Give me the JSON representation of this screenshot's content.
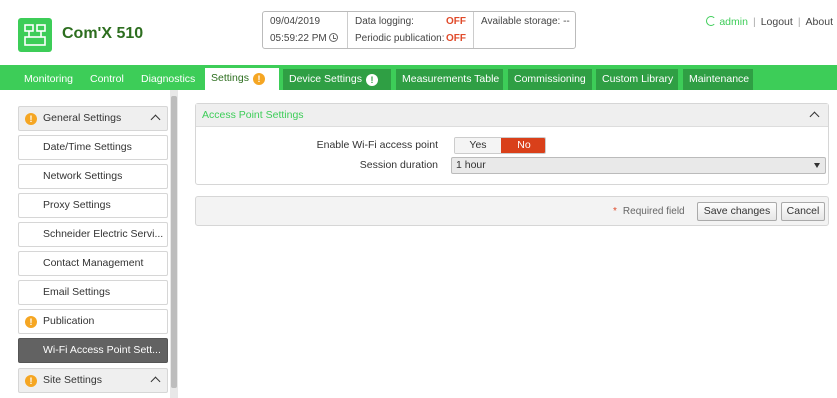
{
  "header": {
    "product_name": "Com'X 510",
    "date": "09/04/2019",
    "time": "05:59:22 PM",
    "data_logging_label": "Data logging:",
    "data_logging_value": "OFF",
    "periodic_publication_label": "Periodic publication:",
    "periodic_publication_value": "OFF",
    "available_storage": "Available storage: --",
    "user": "admin",
    "logout": "Logout",
    "about": "About"
  },
  "nav": {
    "tabs": [
      {
        "label": "Monitoring"
      },
      {
        "label": "Control"
      },
      {
        "label": "Diagnostics"
      },
      {
        "label": "Settings",
        "active": true,
        "warning": "!"
      },
      {
        "label": "Device Settings",
        "warning": "!"
      },
      {
        "label": "Measurements Table"
      },
      {
        "label": "Commissioning"
      },
      {
        "label": "Custom Library"
      },
      {
        "label": "Maintenance"
      }
    ]
  },
  "sidebar": {
    "items": [
      {
        "label": "General Settings",
        "type": "group",
        "warning": "!"
      },
      {
        "label": "Date/Time Settings"
      },
      {
        "label": "Network Settings"
      },
      {
        "label": "Proxy Settings"
      },
      {
        "label": "Schneider Electric Servi..."
      },
      {
        "label": "Contact Management"
      },
      {
        "label": "Email Settings"
      },
      {
        "label": "Publication",
        "warning": "!"
      },
      {
        "label": "Wi-Fi Access Point Sett...",
        "selected": true
      },
      {
        "label": "Site Settings",
        "type": "group",
        "warning": "!"
      }
    ]
  },
  "panel": {
    "title": "Access Point Settings",
    "enable_label": "Enable Wi-Fi access point",
    "yes_label": "Yes",
    "no_label": "No",
    "enable_value": "No",
    "session_label": "Session duration",
    "session_value": "1 hour"
  },
  "footer": {
    "required_star": "*",
    "required_label": "Required field",
    "save_label": "Save changes",
    "cancel_label": "Cancel"
  },
  "colors": {
    "brand_green": "#3dcd58",
    "dark_green": "#2d6e1f",
    "off_red": "#e04a2a",
    "no_red": "#d9401a",
    "warning_orange": "#f5a623",
    "selected_gray": "#626262"
  }
}
